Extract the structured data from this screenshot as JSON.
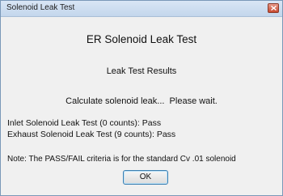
{
  "window": {
    "title": "Solenoid Leak Test"
  },
  "dialog": {
    "heading": "ER Solenoid Leak Test",
    "subheading": "Leak Test Results",
    "status": "Calculate solenoid leak...  Please wait.",
    "results": [
      "Inlet Solenoid Leak Test (0 counts): Pass",
      "Exhaust Solenoid Leak Test (9 counts): Pass"
    ],
    "note": "Note: The PASS/FAIL criteria is for the standard Cv .01 solenoid",
    "ok_label": "OK"
  },
  "icons": {
    "close": "close-icon"
  },
  "colors": {
    "titlebar": "#c3d6ec",
    "close_button": "#c8492f",
    "background": "#f0f0f0"
  }
}
